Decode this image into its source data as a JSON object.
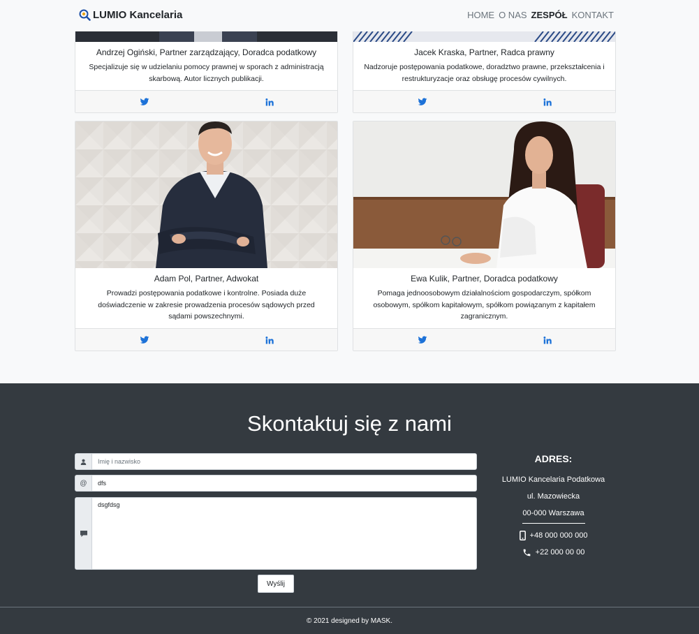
{
  "navbar": {
    "brand": "LUMIO Kancelaria",
    "links": [
      "HOME",
      "O NAS",
      "ZESPÓŁ",
      "KONTAKT"
    ],
    "active": "ZESPÓŁ"
  },
  "team": [
    {
      "name": "Andrzej Ogiński, Partner zarządzający, Doradca podatkowy",
      "desc": "Specjalizuje się w udzielaniu pomocy prawnej w sporach z administracją skarbową. Autor licznych publikacji."
    },
    {
      "name": "Jacek Kraska, Partner, Radca prawny",
      "desc": "Nadzoruje postępowania podatkowe, doradztwo prawne, przekształcenia i restrukturyzacje oraz obsługę procesów cywilnych."
    },
    {
      "name": "Adam Pol, Partner, Adwokat",
      "desc": "Prowadzi postępowania podatkowe i kontrolne. Posiada duże doświadczenie w zakresie prowadzenia procesów sądowych przed sądami powszechnymi."
    },
    {
      "name": "Ewa Kulik, Partner, Doradca podatkowy",
      "desc": "Pomaga jednoosobowym działalnościom gospodarczym, spółkom osobowym, spółkom kapitałowym, spółkom powiązanym z kapitałem zagranicznym."
    }
  ],
  "contact": {
    "title": "Skontaktuj się z nami",
    "name_placeholder": "Imię i nazwisko",
    "email_value": "dfs",
    "message_value": "dsgfdsg",
    "send_label": "Wyślij",
    "email_addon": "@"
  },
  "address": {
    "title": "ADRES:",
    "company": "LUMIO Kancelaria Podatkowa",
    "street": "ul. Mazowiecka",
    "city": "00-000 Warszawa",
    "mobile": "+48 000 000 000",
    "phone": "+22 000 00 00"
  },
  "footer": {
    "text": "© 2021 designed by MASK."
  },
  "colors": {
    "dark": "#343a40",
    "link_blue": "#1d72d8",
    "page_bg": "#f8f9fa"
  }
}
